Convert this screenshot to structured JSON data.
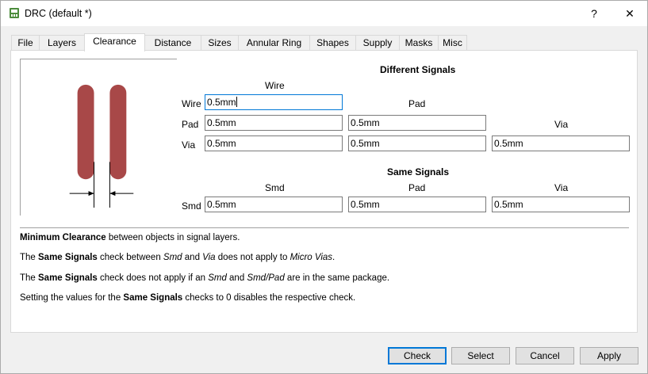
{
  "window": {
    "title": "DRC (default *)",
    "help_glyph": "?",
    "close_glyph": "✕"
  },
  "tabs": [
    {
      "label": "File"
    },
    {
      "label": "Layers"
    },
    {
      "label": "Clearance",
      "active": true
    },
    {
      "label": "Distance"
    },
    {
      "label": "Sizes"
    },
    {
      "label": "Annular Ring"
    },
    {
      "label": "Shapes"
    },
    {
      "label": "Supply"
    },
    {
      "label": "Masks"
    },
    {
      "label": "Misc"
    }
  ],
  "different_signals": {
    "title": "Different Signals",
    "col_wire": "Wire",
    "col_pad": "Pad",
    "col_via": "Via",
    "row_wire": "Wire",
    "row_pad": "Pad",
    "row_via": "Via",
    "wire_wire": "0.5mm",
    "pad_wire": "0.5mm",
    "pad_pad": "0.5mm",
    "via_wire": "0.5mm",
    "via_pad": "0.5mm",
    "via_via": "0.5mm"
  },
  "same_signals": {
    "title": "Same Signals",
    "col_smd": "Smd",
    "col_pad": "Pad",
    "col_via": "Via",
    "row_smd": "Smd",
    "smd_smd": "0.5mm",
    "smd_pad": "0.5mm",
    "smd_via": "0.5mm"
  },
  "info": {
    "line1": {
      "b1": "Minimum Clearance",
      "t1": " between objects in signal layers."
    },
    "line2": {
      "t0": "The ",
      "b1": "Same Signals",
      "t1": " check between ",
      "i1": "Smd",
      "t2": " and ",
      "i2": "Via",
      "t3": " does not apply to ",
      "i3": "Micro Vias",
      "t4": "."
    },
    "line3": {
      "t0": "The ",
      "b1": "Same Signals",
      "t1": " check does not apply if an ",
      "i1": "Smd",
      "t2": " and ",
      "i2": "Smd/Pad",
      "t3": " are in the same package."
    },
    "line4": {
      "t0": "Setting the values for the ",
      "b1": "Same Signals",
      "t1": " checks to 0 disables the respective check."
    }
  },
  "buttons": {
    "check": "Check",
    "select": "Select",
    "cancel": "Cancel",
    "apply": "Apply"
  },
  "colors": {
    "track": "#a84848",
    "focus": "#0078d7"
  }
}
